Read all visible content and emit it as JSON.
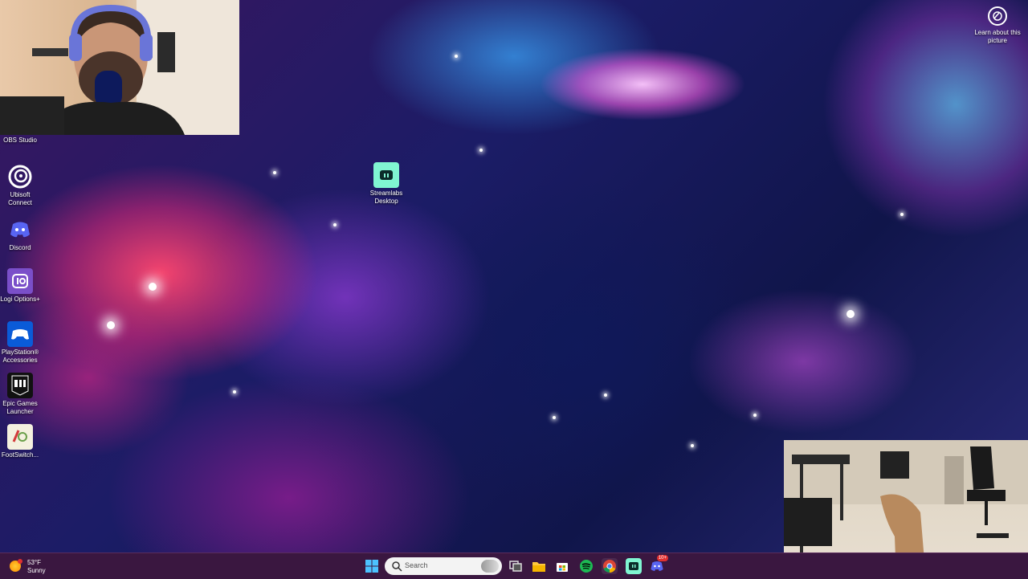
{
  "desktop": {
    "icons": [
      {
        "id": "obs-studio",
        "label": "OBS Studio"
      },
      {
        "id": "ubisoft-connect",
        "label": "Ubisoft Connect"
      },
      {
        "id": "discord",
        "label": "Discord"
      },
      {
        "id": "logi-options",
        "label": "Logi Options+"
      },
      {
        "id": "playstation-accessories",
        "label": "PlayStation® Accessories"
      },
      {
        "id": "epic-games-launcher",
        "label": "Epic Games Launcher"
      },
      {
        "id": "footswitch",
        "label": "FootSwitch..."
      },
      {
        "id": "streamlabs-desktop",
        "label": "Streamlabs Desktop"
      }
    ],
    "spotlight_label": "Learn about this picture"
  },
  "taskbar": {
    "weather": {
      "temperature": "53°F",
      "condition": "Sunny"
    },
    "search_placeholder": "Search",
    "discord_badge": "10+",
    "apps": [
      {
        "name": "start-button-icon"
      },
      {
        "name": "search-box"
      },
      {
        "name": "task-view-icon"
      },
      {
        "name": "file-explorer-icon"
      },
      {
        "name": "microsoft-store-icon"
      },
      {
        "name": "spotify-icon"
      },
      {
        "name": "chrome-icon"
      },
      {
        "name": "streamlabs-icon"
      },
      {
        "name": "discord-icon"
      }
    ]
  },
  "colors": {
    "taskbar_bg": "#3a1740",
    "streamlabs_green": "#80f5d2",
    "discord_blurple": "#5865f2",
    "spotify_green": "#1db954"
  }
}
